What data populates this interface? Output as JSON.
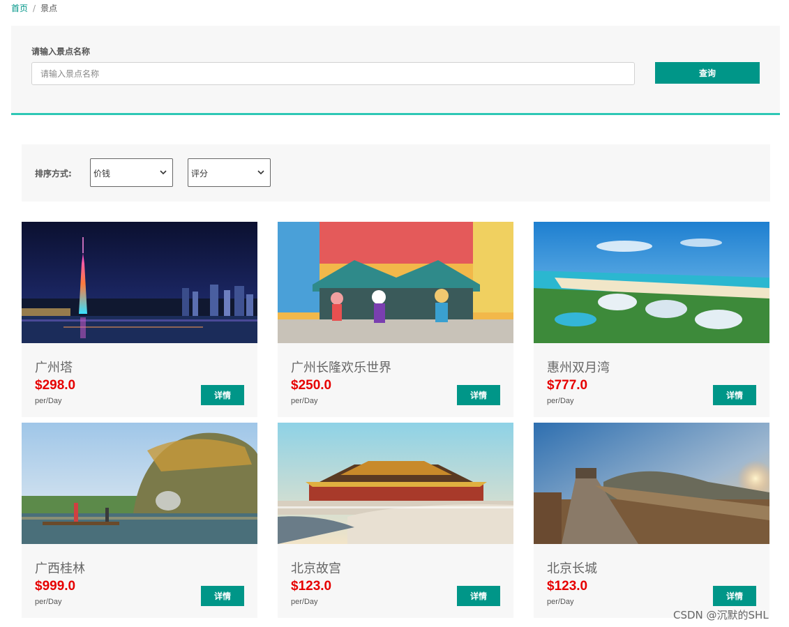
{
  "breadcrumb": {
    "home": "首页",
    "separator": "/",
    "current": "景点"
  },
  "search": {
    "label": "请输入景点名称",
    "placeholder": "请输入景点名称",
    "value": "",
    "button": "查询"
  },
  "sort": {
    "label": "排序方式:",
    "price_select": {
      "selected": "价钱"
    },
    "rating_select": {
      "selected": "评分"
    }
  },
  "attractions": [
    {
      "name": "广州塔",
      "price": "$298.0",
      "unit": "per/Day",
      "button": "详情"
    },
    {
      "name": "广州长隆欢乐世界",
      "price": "$250.0",
      "unit": "per/Day",
      "button": "详情"
    },
    {
      "name": "惠州双月湾",
      "price": "$777.0",
      "unit": "per/Day",
      "button": "详情"
    },
    {
      "name": "广西桂林",
      "price": "$999.0",
      "unit": "per/Day",
      "button": "详情"
    },
    {
      "name": "北京故宫",
      "price": "$123.0",
      "unit": "per/Day",
      "button": "详情"
    },
    {
      "name": "北京长城",
      "price": "$123.0",
      "unit": "per/Day",
      "button": "详情"
    }
  ],
  "watermark": "CSDN @沉默的SHL",
  "colors": {
    "accent": "#009688",
    "divider": "#2ec7b5",
    "price": "#e60000",
    "panel": "#f7f7f7"
  }
}
